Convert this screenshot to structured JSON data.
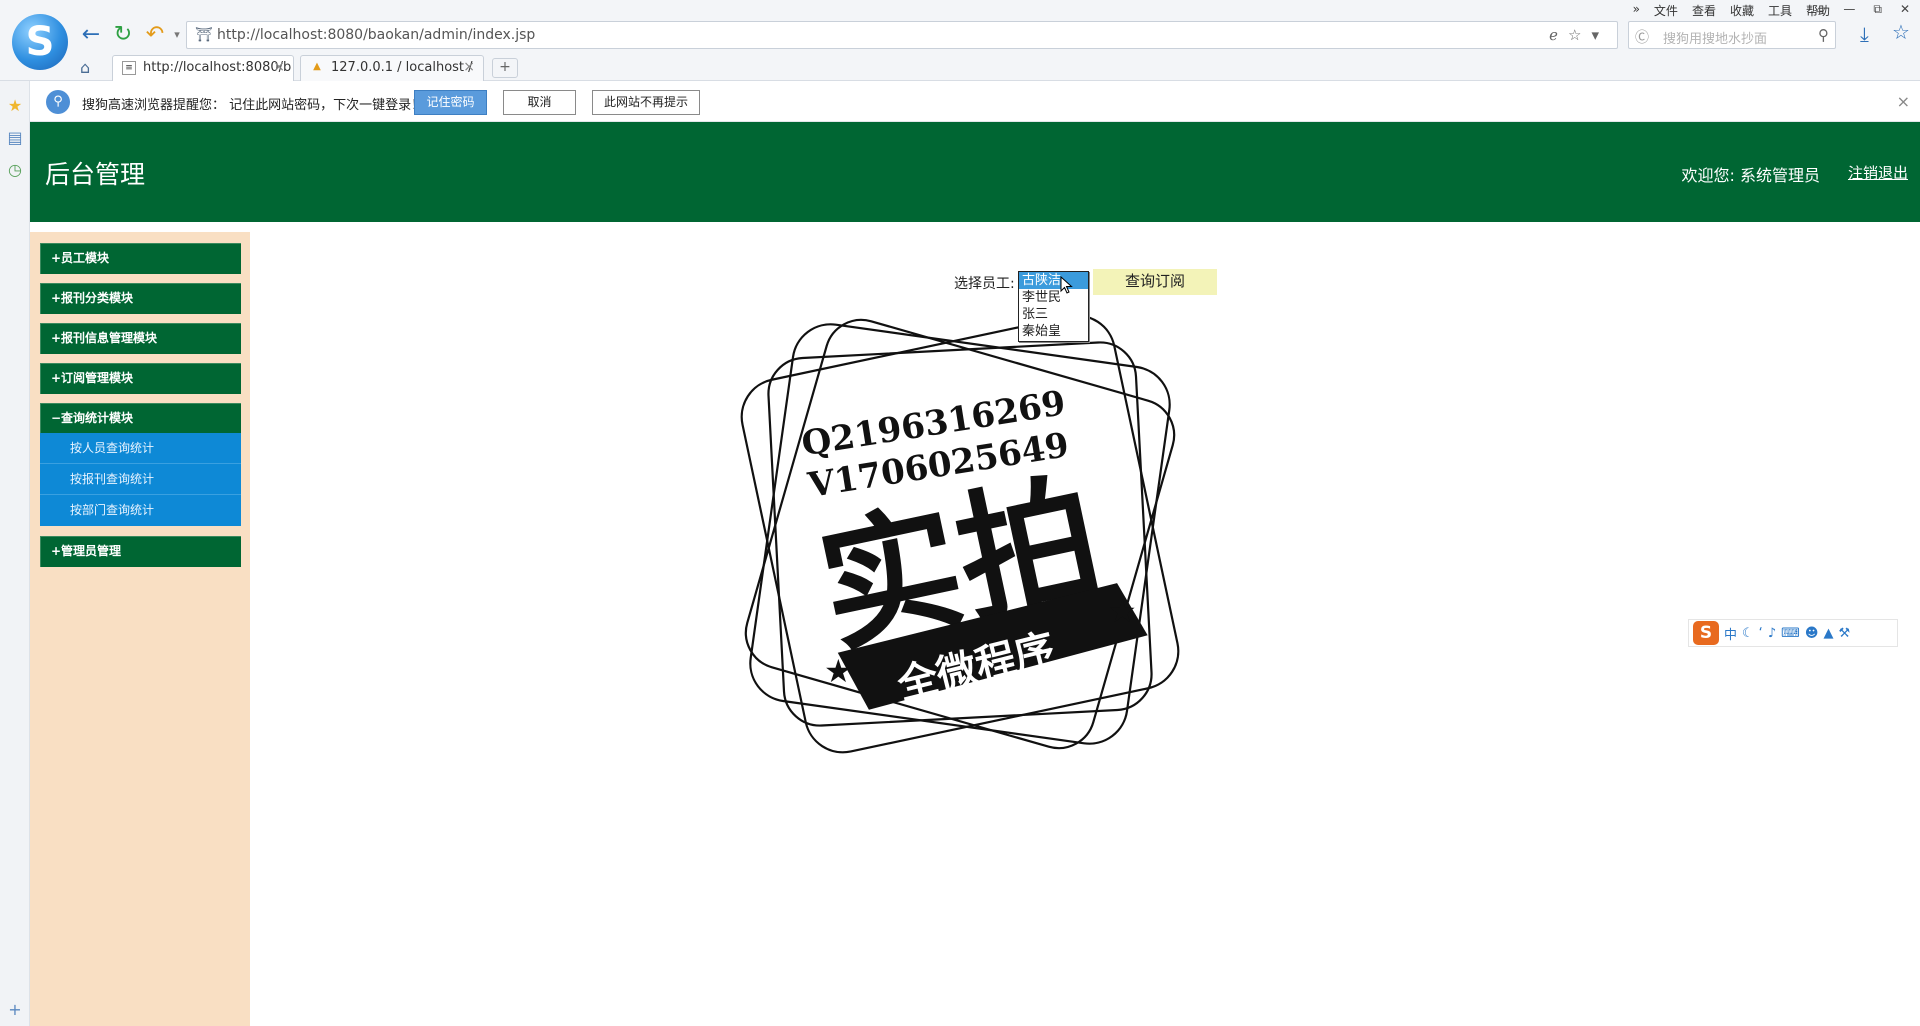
{
  "browser": {
    "url": "http://localhost:8080/baokan/admin/index.jsp",
    "search_placeholder": "搜狗用搜地水抄面",
    "menu": [
      "文件",
      "查看",
      "收藏",
      "工具",
      "帮助"
    ],
    "tabs": [
      {
        "label": "http://localhost:8080/b"
      },
      {
        "label": "127.0.0.1 / localhost / "
      }
    ],
    "new_tab": "+"
  },
  "password_bar": {
    "message": "搜狗高速浏览器提醒您：  记住此网站密码，下次一键登录！",
    "remember": "记住密码",
    "cancel": "取消",
    "never": "此网站不再提示"
  },
  "header": {
    "title": "后台管理",
    "welcome": "欢迎您:   系统管理员",
    "logout": "注销退出"
  },
  "sidebar": {
    "modules": [
      {
        "sign": "+",
        "label": "员工模块"
      },
      {
        "sign": "+",
        "label": "报刊分类模块"
      },
      {
        "sign": "+",
        "label": "报刊信息管理模块"
      },
      {
        "sign": "+",
        "label": "订阅管理模块"
      },
      {
        "sign": "−",
        "label": "查询统计模块"
      },
      {
        "sign": "+",
        "label": "管理员管理"
      }
    ],
    "submenu": [
      "按人员查询统计",
      "按报刊查询统计",
      "按部门查询统计"
    ]
  },
  "main": {
    "employee_label": "选择员工:",
    "employees": [
      "古陕洁",
      "李世民",
      "张三",
      "秦始皇"
    ],
    "selected_index": 0,
    "query_button": "查询订阅"
  },
  "watermark": {
    "line1": "Q2196316269",
    "line2": "V1706025649",
    "big_text": "实拍",
    "banner": "全微程序"
  },
  "ime": {
    "logo": "S",
    "mode": "中"
  }
}
